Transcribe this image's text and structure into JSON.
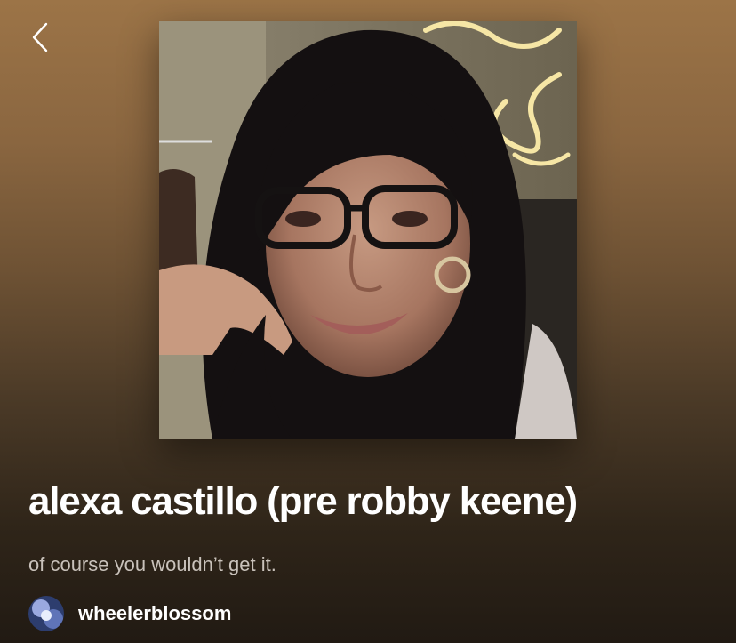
{
  "header": {
    "back_icon": "chevron-left-icon"
  },
  "playlist": {
    "cover_image": "profile-photo",
    "title": "alexa castillo (pre robby keene)",
    "description": "of course you wouldn’t get it.",
    "owner": {
      "name": "wheelerblossom",
      "avatar": "user-avatar"
    }
  },
  "colors": {
    "gradient_top": "#9c7447",
    "gradient_bottom": "#211a13",
    "description_text": "#c9c2bb",
    "title_text": "#ffffff"
  }
}
